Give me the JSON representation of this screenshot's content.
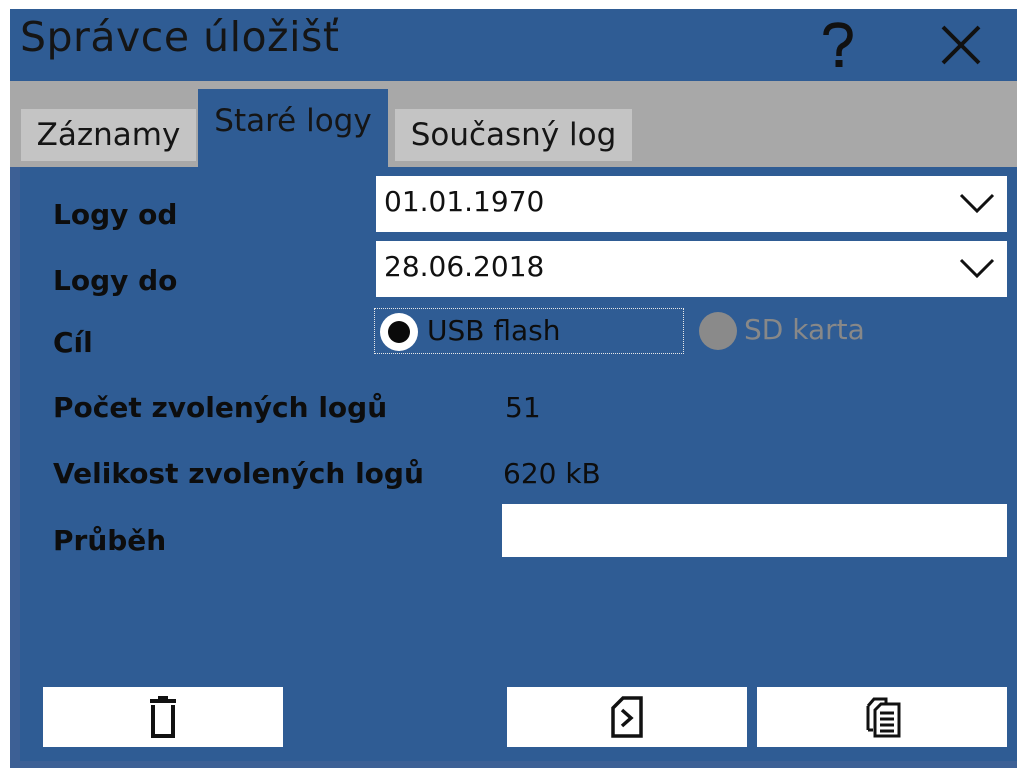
{
  "window": {
    "title": "Správce úložišť",
    "icons": {
      "help": "help-icon",
      "close": "close-icon"
    }
  },
  "tabs": [
    {
      "label": "Záznamy",
      "active": false
    },
    {
      "label": "Staré logy",
      "active": true
    },
    {
      "label": "Současný log",
      "active": false
    }
  ],
  "form": {
    "from_label": "Logy od",
    "from_value": "01.01.1970",
    "to_label": "Logy do",
    "to_value": "28.06.2018",
    "target_label": "Cíl",
    "target_options": [
      {
        "label": "USB flash",
        "selected": true,
        "enabled": true
      },
      {
        "label": "SD karta",
        "selected": false,
        "enabled": false
      }
    ],
    "count_label": "Počet zvolených logů",
    "count_value": "51",
    "size_label": "Velikost zvolených logů",
    "size_value": "620 kB",
    "progress_label": "Průběh",
    "progress_fraction": 0
  },
  "buttons": {
    "delete_icon": "trash-icon",
    "export_icon": "export-to-card-icon",
    "copy_icon": "copy-documents-icon"
  },
  "colors": {
    "panel_background": "#2f5c94",
    "tab_inactive": "#c4c4c4",
    "field_background": "#ffffff",
    "disabled_text": "#888888"
  }
}
